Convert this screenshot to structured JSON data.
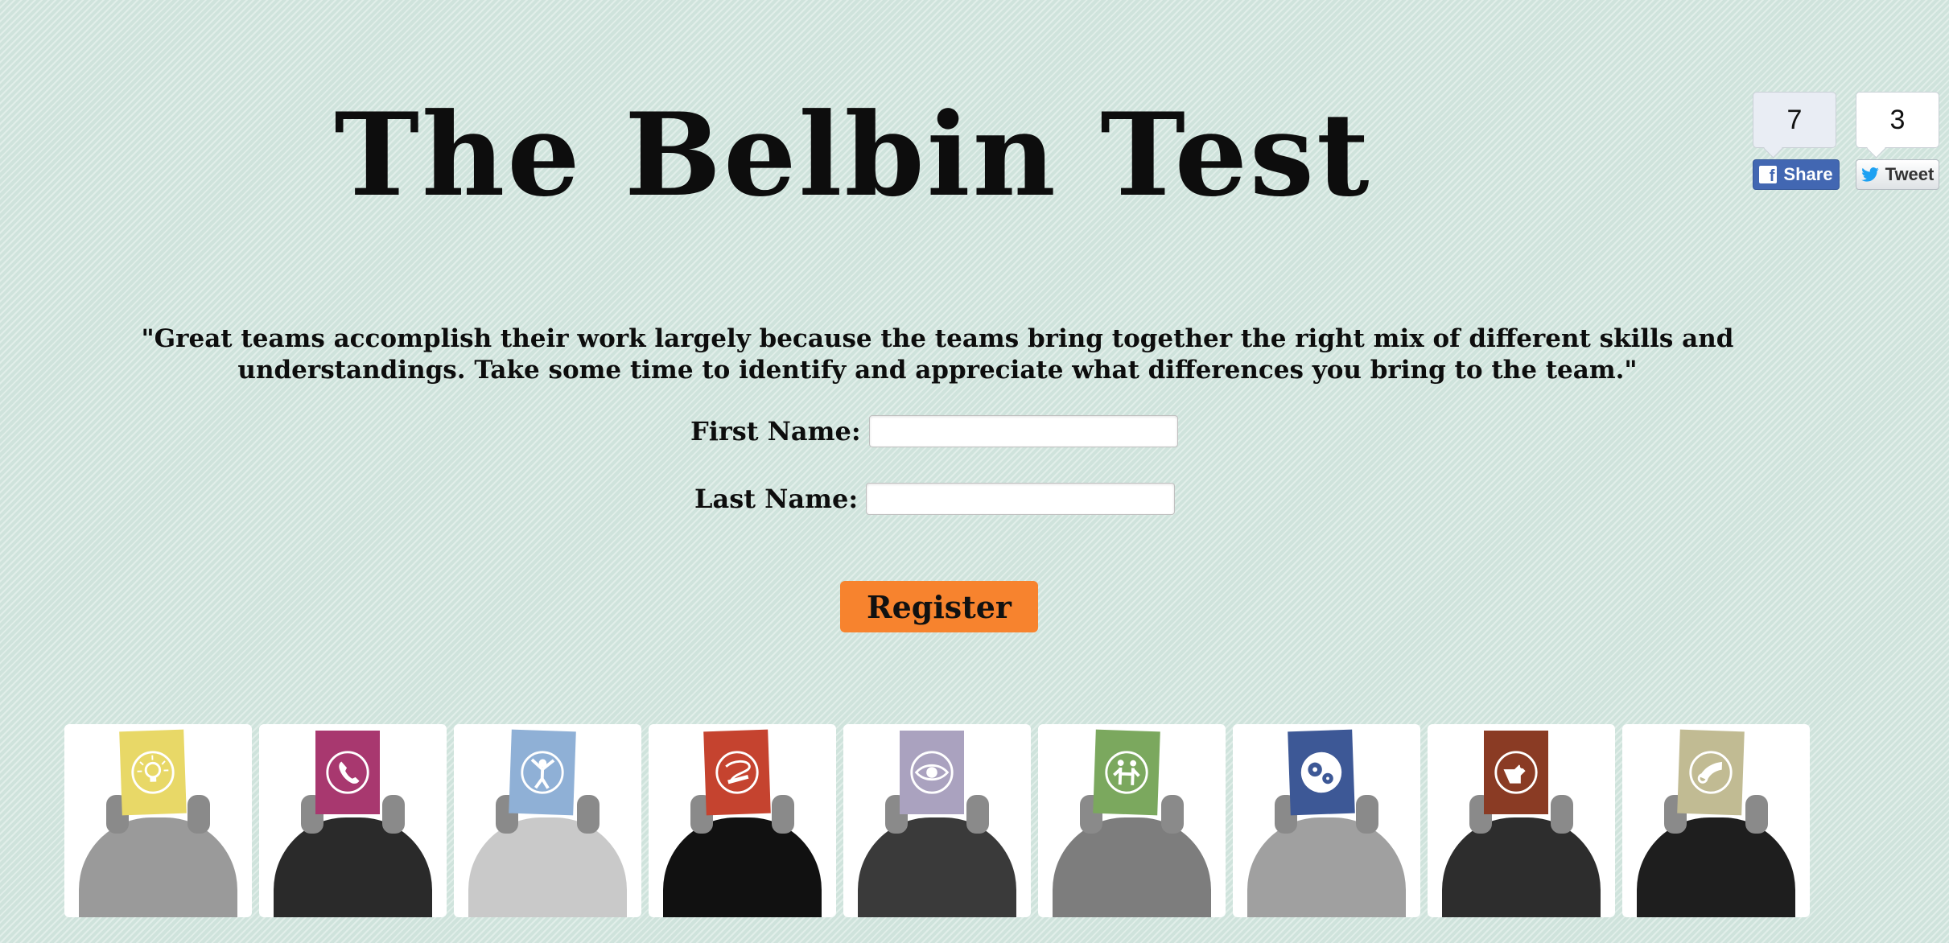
{
  "header": {
    "title": "The Belbin Test"
  },
  "social": {
    "facebook": {
      "count": "7",
      "label": "Share",
      "icon": "facebook-icon"
    },
    "twitter": {
      "count": "3",
      "label": "Tweet",
      "icon": "twitter-bird-icon"
    }
  },
  "quote": "\"Great teams accomplish their work largely because the teams bring together the right mix of different skills and understandings. Take some time to identify and appreciate what differences you bring to the team.\"",
  "form": {
    "first_name": {
      "label": "First Name:",
      "value": ""
    },
    "last_name": {
      "label": "Last Name:",
      "value": ""
    },
    "register_label": "Register"
  },
  "gallery": {
    "items": [
      {
        "color": "#e8d867",
        "icon": "lightbulb-icon"
      },
      {
        "color": "#a8386f",
        "icon": "telephone-icon"
      },
      {
        "color": "#8fb0d6",
        "icon": "person-arms-up-icon"
      },
      {
        "color": "#c5432f",
        "icon": "whip-icon"
      },
      {
        "color": "#aaa2bf",
        "icon": "eye-icon"
      },
      {
        "color": "#7ba85e",
        "icon": "people-holding-hands-icon"
      },
      {
        "color": "#3d5896",
        "icon": "gears-icon"
      },
      {
        "color": "#8a3b24",
        "icon": "hand-screw-icon"
      },
      {
        "color": "#c1bb93",
        "icon": "horn-icon"
      }
    ]
  },
  "colors": {
    "background": "#cfe3dc",
    "register_button": "#f7832e",
    "facebook": "#4267b2"
  }
}
